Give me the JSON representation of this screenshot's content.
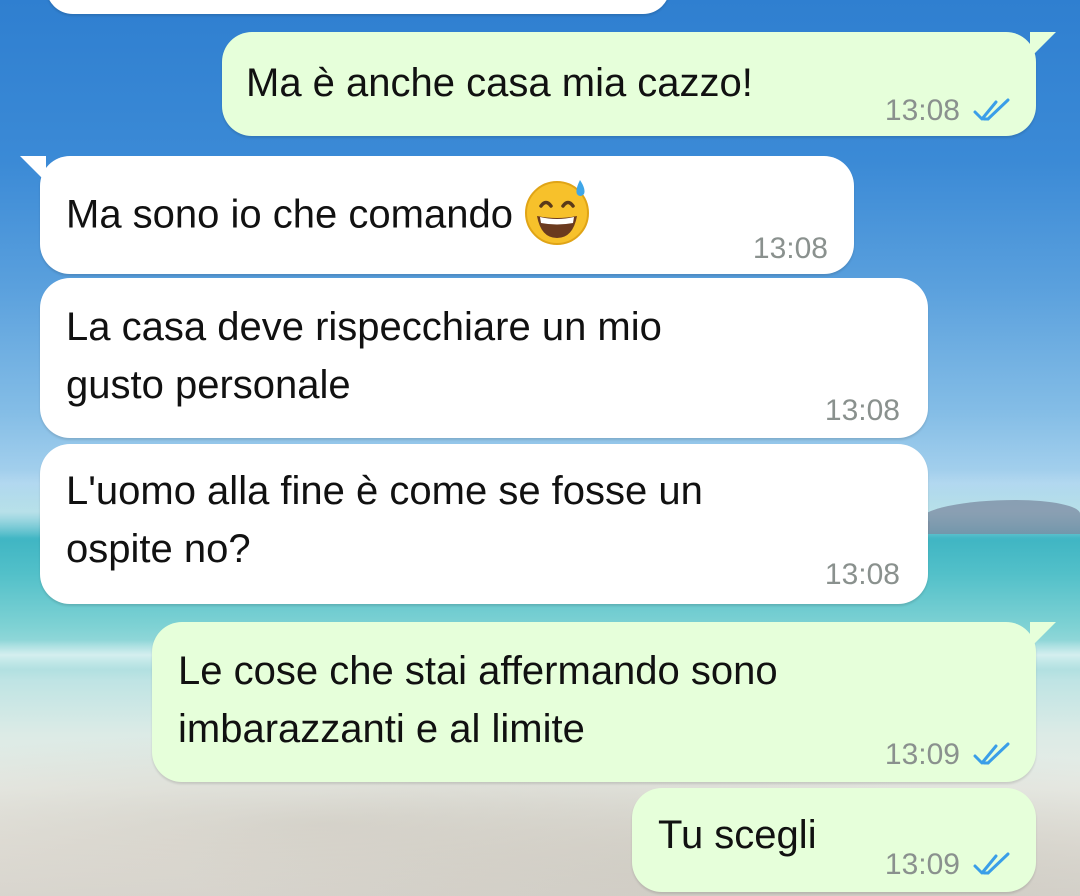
{
  "colors": {
    "outgoing_bubble": "#e6ffda",
    "incoming_bubble": "#ffffff",
    "read_ticks": "#3a9ee8",
    "timestamp": "#8a918e"
  },
  "messages": [
    {
      "direction": "outgoing",
      "text": "Ma è anche casa mia cazzo!",
      "time": "13:08",
      "status_icon": "double-check-read-icon"
    },
    {
      "direction": "incoming",
      "text": "Ma sono io che comando",
      "emoji": "grinning-face-with-sweat-icon",
      "time": "13:08"
    },
    {
      "direction": "incoming",
      "line1": "La casa deve rispecchiare un mio",
      "line2": "gusto personale",
      "time": "13:08"
    },
    {
      "direction": "incoming",
      "line1": "L'uomo alla fine è come se fosse un",
      "line2": "ospite no?",
      "time": "13:08"
    },
    {
      "direction": "outgoing",
      "line1": "Le cose che stai affermando sono",
      "line2": "imbarazzanti e al limite",
      "time": "13:09",
      "status_icon": "double-check-read-icon"
    },
    {
      "direction": "outgoing",
      "text": "Tu scegli",
      "time": "13:09",
      "status_icon": "double-check-read-icon"
    }
  ]
}
